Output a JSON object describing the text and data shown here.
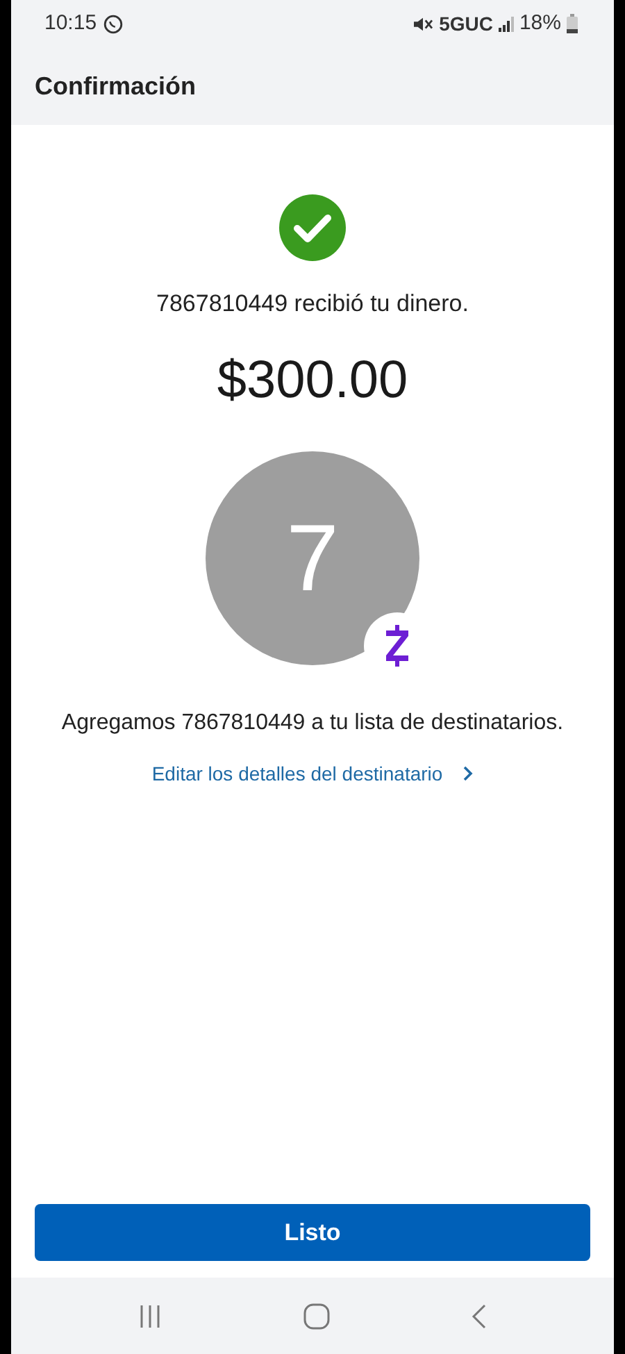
{
  "status_bar": {
    "time": "10:15",
    "network": "5GUC",
    "battery": "18%"
  },
  "header": {
    "title": "Confirmación"
  },
  "confirmation": {
    "message": "7867810449 recibió tu dinero.",
    "amount": "$300.00",
    "avatar_initial": "7",
    "recipient_note": "Agregamos 7867810449 a tu lista de destinatarios.",
    "edit_link": "Editar los detalles del destinatario"
  },
  "primary_button": "Listo"
}
